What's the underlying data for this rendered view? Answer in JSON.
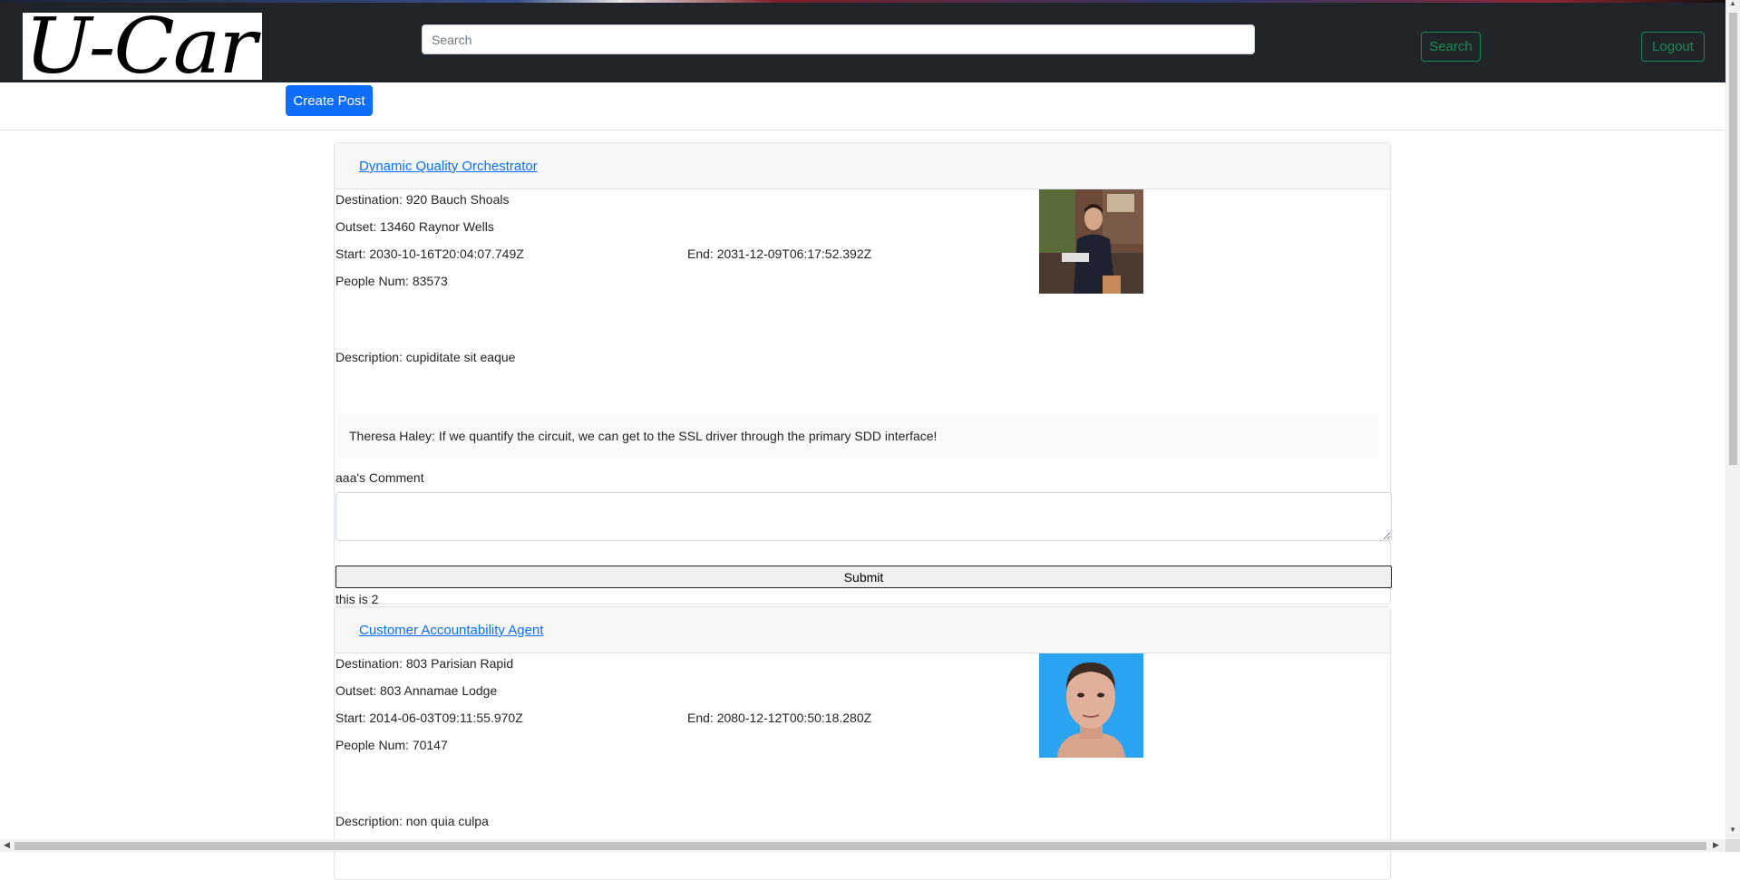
{
  "brand": {
    "logo_text": "U-Car"
  },
  "nav": {
    "search_placeholder": "Search",
    "search_label": "Search",
    "logout_label": "Logout"
  },
  "toolbar": {
    "create_label": "Create Post"
  },
  "posts": [
    {
      "title": "Dynamic Quality Orchestrator",
      "destination": "Destination: 920 Bauch Shoals",
      "outset": "Outset: 13460 Raynor Wells",
      "start": "Start: 2030-10-16T20:04:07.749Z",
      "end": "End: 2031-12-09T06:17:52.392Z",
      "people": "People Num: 83573",
      "description": "Description: cupiditate sit eaque",
      "comments": [
        "Theresa Haley: If we quantify the circuit, we can get to the SSL driver through the primary SDD interface!"
      ],
      "comment_label": "aaa's Comment",
      "submit_label": "Submit",
      "footnote": "this is 2"
    },
    {
      "title": "Customer Accountability Agent",
      "destination": "Destination: 803 Parisian Rapid",
      "outset": "Outset: 803 Annamae Lodge",
      "start": "Start: 2014-06-03T09:11:55.970Z",
      "end": "End: 2080-12-12T00:50:18.280Z",
      "people": "People Num: 70147",
      "description": "Description: non quia culpa"
    }
  ],
  "colors": {
    "navbar": "#212529",
    "primary": "#0d6efd",
    "success": "#198754",
    "photo2_background": "#2aa3f0"
  }
}
